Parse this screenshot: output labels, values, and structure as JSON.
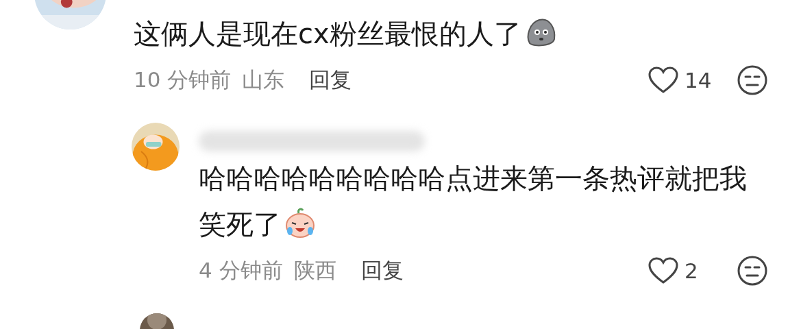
{
  "comments": [
    {
      "kind": "top",
      "text": "这俩人是现在cx粉丝最恨的人了",
      "time": "10 分钟前",
      "region": "山东",
      "reply": "回复",
      "likes": "14",
      "liked": false
    },
    {
      "kind": "reply",
      "text": "哈哈哈哈哈哈哈哈哈点进来第一条热评就把我笑死了",
      "time": "4 分钟前",
      "region": "陕西",
      "reply": "回复",
      "likes": "2",
      "liked": false
    }
  ]
}
